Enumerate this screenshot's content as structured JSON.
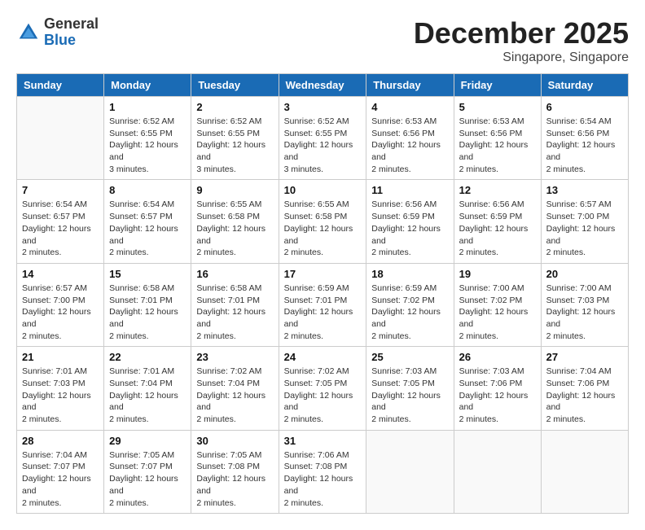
{
  "header": {
    "logo_general": "General",
    "logo_blue": "Blue",
    "month_title": "December 2025",
    "location": "Singapore, Singapore"
  },
  "weekdays": [
    "Sunday",
    "Monday",
    "Tuesday",
    "Wednesday",
    "Thursday",
    "Friday",
    "Saturday"
  ],
  "weeks": [
    [
      {
        "day": "",
        "sunrise": "",
        "sunset": "",
        "daylight": ""
      },
      {
        "day": "1",
        "sunrise": "Sunrise: 6:52 AM",
        "sunset": "Sunset: 6:55 PM",
        "daylight": "Daylight: 12 hours and 3 minutes."
      },
      {
        "day": "2",
        "sunrise": "Sunrise: 6:52 AM",
        "sunset": "Sunset: 6:55 PM",
        "daylight": "Daylight: 12 hours and 3 minutes."
      },
      {
        "day": "3",
        "sunrise": "Sunrise: 6:52 AM",
        "sunset": "Sunset: 6:55 PM",
        "daylight": "Daylight: 12 hours and 3 minutes."
      },
      {
        "day": "4",
        "sunrise": "Sunrise: 6:53 AM",
        "sunset": "Sunset: 6:56 PM",
        "daylight": "Daylight: 12 hours and 2 minutes."
      },
      {
        "day": "5",
        "sunrise": "Sunrise: 6:53 AM",
        "sunset": "Sunset: 6:56 PM",
        "daylight": "Daylight: 12 hours and 2 minutes."
      },
      {
        "day": "6",
        "sunrise": "Sunrise: 6:54 AM",
        "sunset": "Sunset: 6:56 PM",
        "daylight": "Daylight: 12 hours and 2 minutes."
      }
    ],
    [
      {
        "day": "7",
        "sunrise": "Sunrise: 6:54 AM",
        "sunset": "Sunset: 6:57 PM",
        "daylight": "Daylight: 12 hours and 2 minutes."
      },
      {
        "day": "8",
        "sunrise": "Sunrise: 6:54 AM",
        "sunset": "Sunset: 6:57 PM",
        "daylight": "Daylight: 12 hours and 2 minutes."
      },
      {
        "day": "9",
        "sunrise": "Sunrise: 6:55 AM",
        "sunset": "Sunset: 6:58 PM",
        "daylight": "Daylight: 12 hours and 2 minutes."
      },
      {
        "day": "10",
        "sunrise": "Sunrise: 6:55 AM",
        "sunset": "Sunset: 6:58 PM",
        "daylight": "Daylight: 12 hours and 2 minutes."
      },
      {
        "day": "11",
        "sunrise": "Sunrise: 6:56 AM",
        "sunset": "Sunset: 6:59 PM",
        "daylight": "Daylight: 12 hours and 2 minutes."
      },
      {
        "day": "12",
        "sunrise": "Sunrise: 6:56 AM",
        "sunset": "Sunset: 6:59 PM",
        "daylight": "Daylight: 12 hours and 2 minutes."
      },
      {
        "day": "13",
        "sunrise": "Sunrise: 6:57 AM",
        "sunset": "Sunset: 7:00 PM",
        "daylight": "Daylight: 12 hours and 2 minutes."
      }
    ],
    [
      {
        "day": "14",
        "sunrise": "Sunrise: 6:57 AM",
        "sunset": "Sunset: 7:00 PM",
        "daylight": "Daylight: 12 hours and 2 minutes."
      },
      {
        "day": "15",
        "sunrise": "Sunrise: 6:58 AM",
        "sunset": "Sunset: 7:01 PM",
        "daylight": "Daylight: 12 hours and 2 minutes."
      },
      {
        "day": "16",
        "sunrise": "Sunrise: 6:58 AM",
        "sunset": "Sunset: 7:01 PM",
        "daylight": "Daylight: 12 hours and 2 minutes."
      },
      {
        "day": "17",
        "sunrise": "Sunrise: 6:59 AM",
        "sunset": "Sunset: 7:01 PM",
        "daylight": "Daylight: 12 hours and 2 minutes."
      },
      {
        "day": "18",
        "sunrise": "Sunrise: 6:59 AM",
        "sunset": "Sunset: 7:02 PM",
        "daylight": "Daylight: 12 hours and 2 minutes."
      },
      {
        "day": "19",
        "sunrise": "Sunrise: 7:00 AM",
        "sunset": "Sunset: 7:02 PM",
        "daylight": "Daylight: 12 hours and 2 minutes."
      },
      {
        "day": "20",
        "sunrise": "Sunrise: 7:00 AM",
        "sunset": "Sunset: 7:03 PM",
        "daylight": "Daylight: 12 hours and 2 minutes."
      }
    ],
    [
      {
        "day": "21",
        "sunrise": "Sunrise: 7:01 AM",
        "sunset": "Sunset: 7:03 PM",
        "daylight": "Daylight: 12 hours and 2 minutes."
      },
      {
        "day": "22",
        "sunrise": "Sunrise: 7:01 AM",
        "sunset": "Sunset: 7:04 PM",
        "daylight": "Daylight: 12 hours and 2 minutes."
      },
      {
        "day": "23",
        "sunrise": "Sunrise: 7:02 AM",
        "sunset": "Sunset: 7:04 PM",
        "daylight": "Daylight: 12 hours and 2 minutes."
      },
      {
        "day": "24",
        "sunrise": "Sunrise: 7:02 AM",
        "sunset": "Sunset: 7:05 PM",
        "daylight": "Daylight: 12 hours and 2 minutes."
      },
      {
        "day": "25",
        "sunrise": "Sunrise: 7:03 AM",
        "sunset": "Sunset: 7:05 PM",
        "daylight": "Daylight: 12 hours and 2 minutes."
      },
      {
        "day": "26",
        "sunrise": "Sunrise: 7:03 AM",
        "sunset": "Sunset: 7:06 PM",
        "daylight": "Daylight: 12 hours and 2 minutes."
      },
      {
        "day": "27",
        "sunrise": "Sunrise: 7:04 AM",
        "sunset": "Sunset: 7:06 PM",
        "daylight": "Daylight: 12 hours and 2 minutes."
      }
    ],
    [
      {
        "day": "28",
        "sunrise": "Sunrise: 7:04 AM",
        "sunset": "Sunset: 7:07 PM",
        "daylight": "Daylight: 12 hours and 2 minutes."
      },
      {
        "day": "29",
        "sunrise": "Sunrise: 7:05 AM",
        "sunset": "Sunset: 7:07 PM",
        "daylight": "Daylight: 12 hours and 2 minutes."
      },
      {
        "day": "30",
        "sunrise": "Sunrise: 7:05 AM",
        "sunset": "Sunset: 7:08 PM",
        "daylight": "Daylight: 12 hours and 2 minutes."
      },
      {
        "day": "31",
        "sunrise": "Sunrise: 7:06 AM",
        "sunset": "Sunset: 7:08 PM",
        "daylight": "Daylight: 12 hours and 2 minutes."
      },
      {
        "day": "",
        "sunrise": "",
        "sunset": "",
        "daylight": ""
      },
      {
        "day": "",
        "sunrise": "",
        "sunset": "",
        "daylight": ""
      },
      {
        "day": "",
        "sunrise": "",
        "sunset": "",
        "daylight": ""
      }
    ]
  ]
}
